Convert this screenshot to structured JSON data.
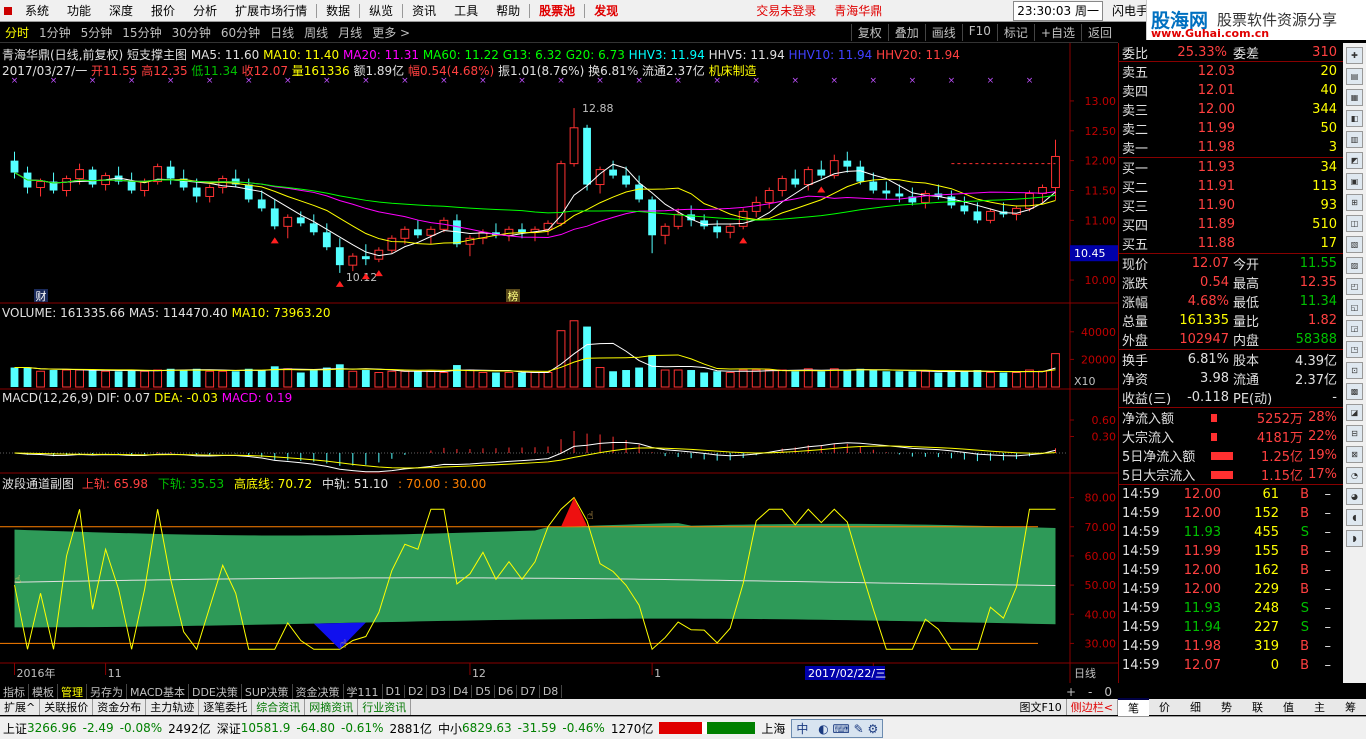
{
  "menu": [
    "系统",
    "功能",
    "深度",
    "报价",
    "分析",
    "扩展市场行情",
    "数据",
    "纵览",
    "资讯",
    "工具",
    "帮助"
  ],
  "menu_red": [
    "股票池",
    "发现"
  ],
  "menu_login": "交易未登录",
  "menu_stock": "青海华鼎",
  "clock": "23:30:03 周一",
  "menu_right": "闪电手",
  "logo": {
    "title": "股海网",
    "subtitle": "股票软件资源分享",
    "url": "www.Guhai.com.cn"
  },
  "periods": [
    "分时",
    "1分钟",
    "5分钟",
    "15分钟",
    "30分钟",
    "60分钟",
    "日线",
    "周线",
    "月线",
    "更多 >"
  ],
  "period_active": "日线",
  "top_buttons": [
    "复权",
    "叠加",
    "画线",
    "F10",
    "标记",
    "+自选",
    "返回"
  ],
  "main_info": {
    "title": "青海华鼎(日线,前复权) 短支撑主图",
    "ma5": "MA5: 11.60",
    "ma10": "MA10: 11.40",
    "ma20": "MA20: 11.31",
    "ma60": "MA60: 11.22",
    "g13": "G13: 6.32",
    "g20": "G20: 6.73",
    "hhv3": "HHV3: 11.94",
    "hhv5": "HHV5: 11.94",
    "hhv10": "HHV10: 11.94",
    "hhv20": "HHV20: 11.94"
  },
  "bar_info": {
    "date": "2017/03/27/一",
    "open": "开11.55",
    "high": "高12.35",
    "low": "低11.34",
    "close": "收12.07",
    "vol": "量161336",
    "amount": "额1.89亿",
    "chg": "幅0.54(4.68%)",
    "amp": "振1.01(8.76%)",
    "turn": "换6.81%",
    "float": "流通2.37亿",
    "industry": "机床制造"
  },
  "price_axis": [
    "13.00",
    "12.50",
    "12.00",
    "11.50",
    "11.00",
    "10.50",
    "10.00"
  ],
  "price_cursor": "10.45",
  "annot_high": "12.88",
  "annot_low": "10.12",
  "annot_cai": "财",
  "annot_bang": "榜",
  "vol_info": {
    "vol": "VOLUME: 161335.66",
    "ma5": "MA5: 114470.40",
    "ma10": "MA10: 73963.20"
  },
  "vol_axis": [
    "40000",
    "20000"
  ],
  "vol_unit": "X10",
  "macd_info": {
    "title": "MACD(12,26,9)",
    "dif": "DIF: 0.07",
    "dea": "DEA: -0.03",
    "macd": "MACD: 0.19"
  },
  "macd_axis": [
    "0.60",
    "0.30"
  ],
  "band_info": {
    "title": "波段通道副图",
    "upper": "上轨: 65.98",
    "lower": "下轨: 35.53",
    "top": "高底线: 70.72",
    "mid": "中轨: 51.10",
    "levels": ": 70.00 : 30.00"
  },
  "band_axis": [
    "80.00",
    "70.00",
    "60.00",
    "50.00",
    "40.00",
    "30.00"
  ],
  "x_axis": [
    "2016年",
    "11",
    "12",
    "1",
    "2"
  ],
  "x_cursor": "2017/02/22/三",
  "x_right": "日线",
  "tabs": [
    "指标",
    "模板",
    "管理",
    "另存为",
    "MACD基本",
    "DDE决策",
    "SUP决策",
    "资金决策",
    "学111",
    "D1",
    "D2",
    "D3",
    "D4",
    "D5",
    "D6",
    "D7",
    "D8"
  ],
  "tab_active": "管理",
  "zoom": [
    "+",
    "-",
    "0"
  ],
  "tabs2": [
    "扩展^",
    "关联报价",
    "资金分布",
    "主力轨迹",
    "逐笔委托",
    "综合资讯",
    "网摘资讯",
    "行业资讯"
  ],
  "tabs2_right": [
    "图文F10",
    "侧边栏<"
  ],
  "rtabs": [
    "笔",
    "价",
    "细",
    "势",
    "联",
    "值",
    "主",
    "筹"
  ],
  "rtab_active": "笔",
  "quote": {
    "wb": {
      "label": "委比",
      "val": "25.33%",
      "label2": "委差",
      "val2": "310"
    },
    "asks": [
      {
        "label": "卖五",
        "price": "12.03",
        "vol": "20"
      },
      {
        "label": "卖四",
        "price": "12.01",
        "vol": "40"
      },
      {
        "label": "卖三",
        "price": "12.00",
        "vol": "344"
      },
      {
        "label": "卖二",
        "price": "11.99",
        "vol": "50"
      },
      {
        "label": "卖一",
        "price": "11.98",
        "vol": "3"
      }
    ],
    "bids": [
      {
        "label": "买一",
        "price": "11.93",
        "vol": "34"
      },
      {
        "label": "买二",
        "price": "11.91",
        "vol": "113"
      },
      {
        "label": "买三",
        "price": "11.90",
        "vol": "93"
      },
      {
        "label": "买四",
        "price": "11.89",
        "vol": "510"
      },
      {
        "label": "买五",
        "price": "11.88",
        "vol": "17"
      }
    ],
    "stats": [
      {
        "l1": "现价",
        "v1": "12.07",
        "c1": "up",
        "l2": "今开",
        "v2": "11.55",
        "c2": "dn"
      },
      {
        "l1": "涨跌",
        "v1": "0.54",
        "c1": "up",
        "l2": "最高",
        "v2": "12.35",
        "c2": "up"
      },
      {
        "l1": "涨幅",
        "v1": "4.68%",
        "c1": "up",
        "l2": "最低",
        "v2": "11.34",
        "c2": "dn"
      },
      {
        "l1": "总量",
        "v1": "161335",
        "c1": "y",
        "l2": "量比",
        "v2": "1.82",
        "c2": "up"
      },
      {
        "l1": "外盘",
        "v1": "102947",
        "c1": "up",
        "l2": "内盘",
        "v2": "58388",
        "c2": "dn"
      }
    ],
    "stats2": [
      {
        "l1": "换手",
        "v1": "6.81%",
        "l2": "股本",
        "v2": "4.39亿"
      },
      {
        "l1": "净资",
        "v1": "3.98",
        "l2": "流通",
        "v2": "2.37亿"
      },
      {
        "l1": "收益(三)",
        "v1": "-0.118",
        "l2": "PE(动)",
        "v2": "-"
      }
    ],
    "flows": [
      {
        "label": "净流入额",
        "val": "5252万",
        "pct": "28%"
      },
      {
        "label": "大宗流入",
        "val": "4181万",
        "pct": "22%"
      },
      {
        "label": "5日净流入额",
        "val": "1.25亿",
        "pct": "19%"
      },
      {
        "label": "5日大宗流入",
        "val": "1.15亿",
        "pct": "17%"
      }
    ],
    "ticks": [
      {
        "t": "14:59",
        "p": "12.00",
        "v": "61",
        "s": "B"
      },
      {
        "t": "14:59",
        "p": "12.00",
        "v": "152",
        "s": "B"
      },
      {
        "t": "14:59",
        "p": "11.93",
        "v": "455",
        "s": "S"
      },
      {
        "t": "14:59",
        "p": "11.99",
        "v": "155",
        "s": "B"
      },
      {
        "t": "14:59",
        "p": "12.00",
        "v": "162",
        "s": "B"
      },
      {
        "t": "14:59",
        "p": "12.00",
        "v": "229",
        "s": "B"
      },
      {
        "t": "14:59",
        "p": "11.93",
        "v": "248",
        "s": "S"
      },
      {
        "t": "14:59",
        "p": "11.94",
        "v": "227",
        "s": "S"
      },
      {
        "t": "14:59",
        "p": "11.98",
        "v": "319",
        "s": "B"
      },
      {
        "t": "14:59",
        "p": "12.07",
        "v": "0",
        "s": "B"
      }
    ],
    "tick_dash": "–"
  },
  "status": {
    "sh_label": "上证",
    "sh_val": "3266.96",
    "sh_chg": "-2.49",
    "sh_pct": "-0.08%",
    "sh_amt": "2492亿",
    "sz_label": "深证",
    "sz_val": "10581.9",
    "sz_chg": "-64.80",
    "sz_pct": "-0.61%",
    "sz_amt": "2881亿",
    "zx_label": "中小",
    "zx_val": "6829.63",
    "zx_chg": "-31.59",
    "zx_pct": "-0.46%",
    "zx_amt": "1270亿",
    "market": "上海",
    "ime": "中"
  },
  "chart_data": {
    "type": "candlestick",
    "note_series": "daily OHLC approx, Nov 2016 - Mar 2017",
    "ohlc": [
      [
        12.0,
        12.15,
        11.7,
        11.8
      ],
      [
        11.8,
        11.9,
        11.45,
        11.55
      ],
      [
        11.55,
        11.7,
        11.4,
        11.65
      ],
      [
        11.65,
        11.8,
        11.45,
        11.5
      ],
      [
        11.5,
        11.75,
        11.4,
        11.7
      ],
      [
        11.7,
        11.95,
        11.6,
        11.85
      ],
      [
        11.85,
        11.9,
        11.55,
        11.6
      ],
      [
        11.6,
        11.8,
        11.5,
        11.75
      ],
      [
        11.75,
        11.9,
        11.6,
        11.65
      ],
      [
        11.65,
        11.8,
        11.45,
        11.5
      ],
      [
        11.5,
        11.7,
        11.4,
        11.65
      ],
      [
        11.65,
        11.95,
        11.6,
        11.9
      ],
      [
        11.9,
        12.0,
        11.6,
        11.7
      ],
      [
        11.7,
        11.85,
        11.5,
        11.55
      ],
      [
        11.55,
        11.7,
        11.3,
        11.4
      ],
      [
        11.4,
        11.6,
        11.3,
        11.55
      ],
      [
        11.55,
        11.75,
        11.45,
        11.7
      ],
      [
        11.7,
        11.85,
        11.55,
        11.6
      ],
      [
        11.6,
        11.7,
        11.3,
        11.35
      ],
      [
        11.35,
        11.5,
        11.15,
        11.2
      ],
      [
        11.2,
        11.35,
        10.85,
        10.9
      ],
      [
        10.9,
        11.1,
        10.7,
        11.05
      ],
      [
        11.05,
        11.15,
        10.9,
        10.95
      ],
      [
        10.95,
        11.1,
        10.75,
        10.8
      ],
      [
        10.8,
        10.95,
        10.5,
        10.55
      ],
      [
        10.55,
        10.7,
        10.12,
        10.25
      ],
      [
        10.25,
        10.45,
        10.15,
        10.4
      ],
      [
        10.4,
        10.6,
        10.25,
        10.35
      ],
      [
        10.35,
        10.55,
        10.3,
        10.5
      ],
      [
        10.5,
        10.75,
        10.45,
        10.7
      ],
      [
        10.7,
        10.9,
        10.6,
        10.85
      ],
      [
        10.85,
        11.0,
        10.7,
        10.75
      ],
      [
        10.75,
        10.9,
        10.6,
        10.85
      ],
      [
        10.85,
        11.05,
        10.8,
        11.0
      ],
      [
        11.0,
        11.1,
        10.55,
        10.6
      ],
      [
        10.6,
        10.75,
        10.4,
        10.7
      ],
      [
        10.7,
        10.85,
        10.6,
        10.8
      ],
      [
        10.8,
        10.95,
        10.7,
        10.75
      ],
      [
        10.75,
        10.9,
        10.65,
        10.85
      ],
      [
        10.85,
        10.95,
        10.7,
        10.8
      ],
      [
        10.8,
        10.9,
        10.65,
        10.85
      ],
      [
        10.85,
        11.0,
        10.75,
        10.95
      ],
      [
        10.95,
        12.0,
        10.9,
        11.95
      ],
      [
        11.95,
        12.88,
        11.9,
        12.55
      ],
      [
        12.55,
        12.6,
        11.5,
        11.6
      ],
      [
        11.6,
        11.9,
        11.45,
        11.85
      ],
      [
        11.85,
        12.0,
        11.7,
        11.75
      ],
      [
        11.75,
        11.9,
        11.55,
        11.6
      ],
      [
        11.6,
        11.75,
        11.3,
        11.35
      ],
      [
        11.35,
        11.4,
        10.45,
        10.75
      ],
      [
        10.75,
        10.95,
        10.6,
        10.9
      ],
      [
        10.9,
        11.2,
        10.85,
        11.1
      ],
      [
        11.1,
        11.25,
        10.9,
        11.0
      ],
      [
        11.0,
        11.1,
        10.85,
        10.9
      ],
      [
        10.9,
        11.0,
        10.7,
        10.8
      ],
      [
        10.8,
        10.95,
        10.7,
        10.9
      ],
      [
        10.9,
        11.2,
        10.85,
        11.15
      ],
      [
        11.15,
        11.4,
        11.05,
        11.3
      ],
      [
        11.3,
        11.55,
        11.2,
        11.5
      ],
      [
        11.5,
        11.75,
        11.4,
        11.7
      ],
      [
        11.7,
        11.85,
        11.55,
        11.6
      ],
      [
        11.6,
        11.9,
        11.5,
        11.85
      ],
      [
        11.85,
        12.0,
        11.7,
        11.75
      ],
      [
        11.75,
        12.1,
        11.7,
        12.0
      ],
      [
        12.0,
        12.15,
        11.8,
        11.9
      ],
      [
        11.9,
        12.0,
        11.6,
        11.65
      ],
      [
        11.65,
        11.8,
        11.45,
        11.5
      ],
      [
        11.5,
        11.65,
        11.35,
        11.45
      ],
      [
        11.45,
        11.6,
        11.3,
        11.4
      ],
      [
        11.4,
        11.55,
        11.25,
        11.3
      ],
      [
        11.3,
        11.5,
        11.2,
        11.45
      ],
      [
        11.45,
        11.6,
        11.35,
        11.4
      ],
      [
        11.4,
        11.5,
        11.2,
        11.25
      ],
      [
        11.25,
        11.4,
        11.1,
        11.15
      ],
      [
        11.15,
        11.3,
        10.95,
        11.0
      ],
      [
        11.0,
        11.2,
        10.95,
        11.15
      ],
      [
        11.15,
        11.3,
        11.05,
        11.1
      ],
      [
        11.1,
        11.25,
        11.0,
        11.2
      ],
      [
        11.2,
        11.5,
        11.15,
        11.45
      ],
      [
        11.45,
        11.6,
        11.3,
        11.55
      ],
      [
        11.55,
        12.35,
        11.34,
        12.07
      ]
    ]
  }
}
